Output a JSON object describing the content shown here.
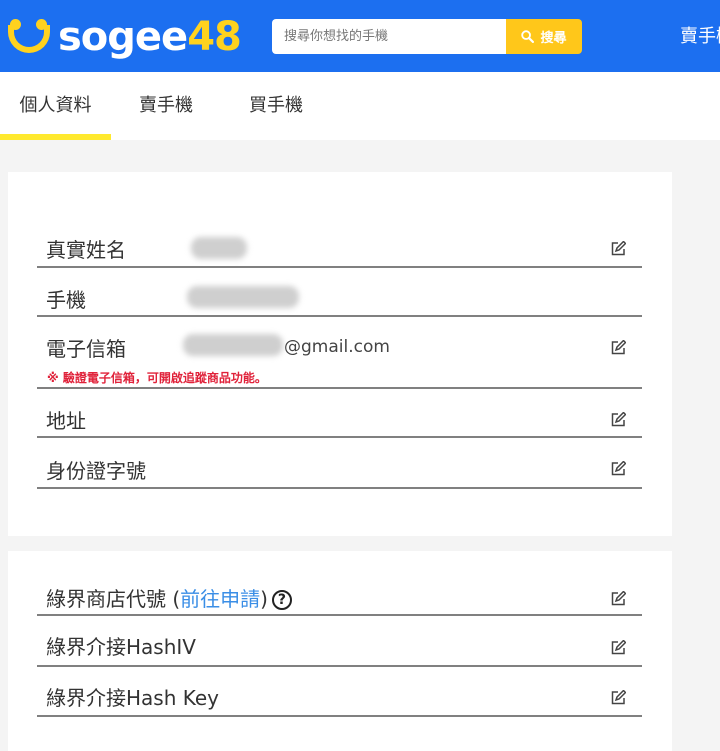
{
  "header": {
    "logo_text_white": "sogee",
    "logo_text_yellow": "48",
    "search_placeholder": "搜尋你想找的手機",
    "search_button": "搜尋",
    "right_link": "賣手機"
  },
  "tabs": [
    {
      "label": "個人資料",
      "active": true
    },
    {
      "label": "賣手機"
    },
    {
      "label": "買手機"
    }
  ],
  "profile": {
    "real_name_label": "真實姓名",
    "phone_label": "手機",
    "email_label": "電子信箱",
    "email_suffix": "@gmail.com",
    "email_hint": "※ 驗證電子信箱，可開啟追蹤商品功能。",
    "address_label": "地址",
    "id_label": "身份證字號"
  },
  "ecpay": {
    "store_label": "綠界商店代號 (",
    "store_link": "前往申請",
    "store_close": ")",
    "help_symbol": "?",
    "hashiv_label": "綠界介接HashIV",
    "hashkey_label": "綠界介接Hash Key"
  },
  "colors": {
    "header_blue": "#1c6ff0",
    "accent_yellow": "#ffc71a",
    "hint_red": "#e0223a",
    "link_blue": "#3a8ee6"
  }
}
